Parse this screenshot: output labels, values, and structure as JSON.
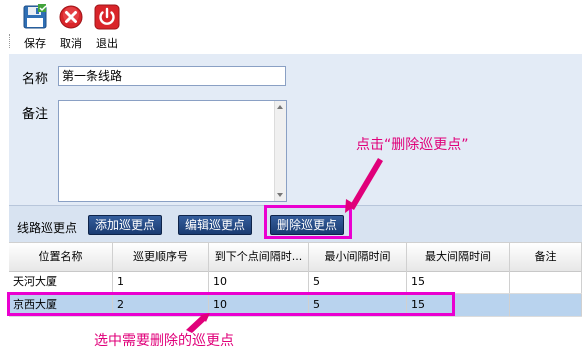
{
  "toolbar": {
    "save_label": "保存",
    "cancel_label": "取消",
    "exit_label": "退出"
  },
  "form": {
    "name_label": "名称",
    "name_value": "第一条线路",
    "note_label": "备注",
    "note_value": ""
  },
  "patrol": {
    "label": "线路巡更点",
    "add_button": "添加巡更点",
    "edit_button": "编辑巡更点",
    "delete_button": "删除巡更点"
  },
  "table": {
    "columns": [
      "位置名称",
      "巡更顺序号",
      "到下个点间隔时...",
      "最小间隔时间",
      "最大间隔时间",
      "备注"
    ],
    "rows": [
      [
        "天河大厦",
        "1",
        "10",
        "5",
        "15",
        ""
      ],
      [
        "京西大厦",
        "2",
        "10",
        "5",
        "15",
        ""
      ]
    ],
    "selected_row": 1
  },
  "annotations": {
    "top": "点击“删除巡更点”",
    "bottom": "选中需要删除的巡更点"
  },
  "colors": {
    "accent": "#ea00d0",
    "annotation_text": "#e0007a",
    "button": "#1f4280",
    "selected_row": "#b9d3ee",
    "form_bg": "#e3ebf6"
  },
  "icons": {
    "save": "floppy-disk-icon",
    "cancel": "cancel-x-icon",
    "exit": "power-icon"
  }
}
